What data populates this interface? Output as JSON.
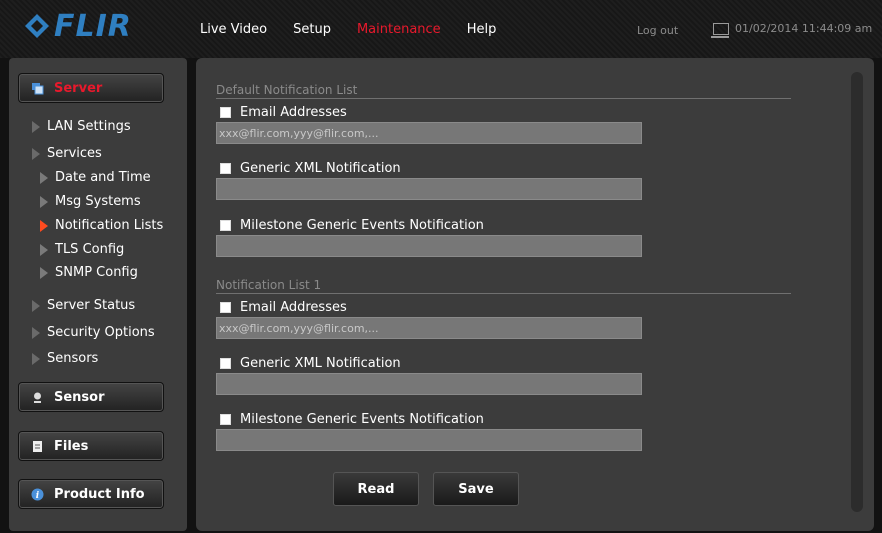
{
  "brand": {
    "logo_text": "FLIR"
  },
  "nav": {
    "items": [
      "Live Video",
      "Setup",
      "Maintenance",
      "Help"
    ],
    "active": "Maintenance"
  },
  "header": {
    "logout": "Log out",
    "datetime": "01/02/2014 11:44:09 am"
  },
  "sidebar": {
    "server_label": "Server",
    "items": [
      {
        "label": "LAN Settings"
      },
      {
        "label": "Services"
      },
      {
        "label": "Date and Time"
      },
      {
        "label": "Msg Systems"
      },
      {
        "label": "Notification Lists"
      },
      {
        "label": "TLS Config"
      },
      {
        "label": "SNMP Config"
      },
      {
        "label": "Server Status"
      },
      {
        "label": "Security Options"
      },
      {
        "label": "Sensors"
      }
    ],
    "sensor_label": "Sensor",
    "files_label": "Files",
    "product_info_label": "Product Info"
  },
  "lists": [
    {
      "title": "Default Notification List",
      "email_label": "Email Addresses",
      "email_placeholder": "xxx@flir.com,yyy@flir.com,...",
      "xml_label": "Generic XML Notification",
      "milestone_label": "Milestone Generic Events Notification"
    },
    {
      "title": "Notification List 1",
      "email_label": "Email Addresses",
      "email_placeholder": "xxx@flir.com,yyy@flir.com,...",
      "xml_label": "Generic XML Notification",
      "milestone_label": "Milestone Generic Events Notification"
    }
  ],
  "buttons": {
    "read": "Read",
    "save": "Save"
  },
  "colors": {
    "accent": "#e8192c",
    "brand_blue": "#2f7fc1",
    "active_arrow": "#ff4b1f"
  }
}
